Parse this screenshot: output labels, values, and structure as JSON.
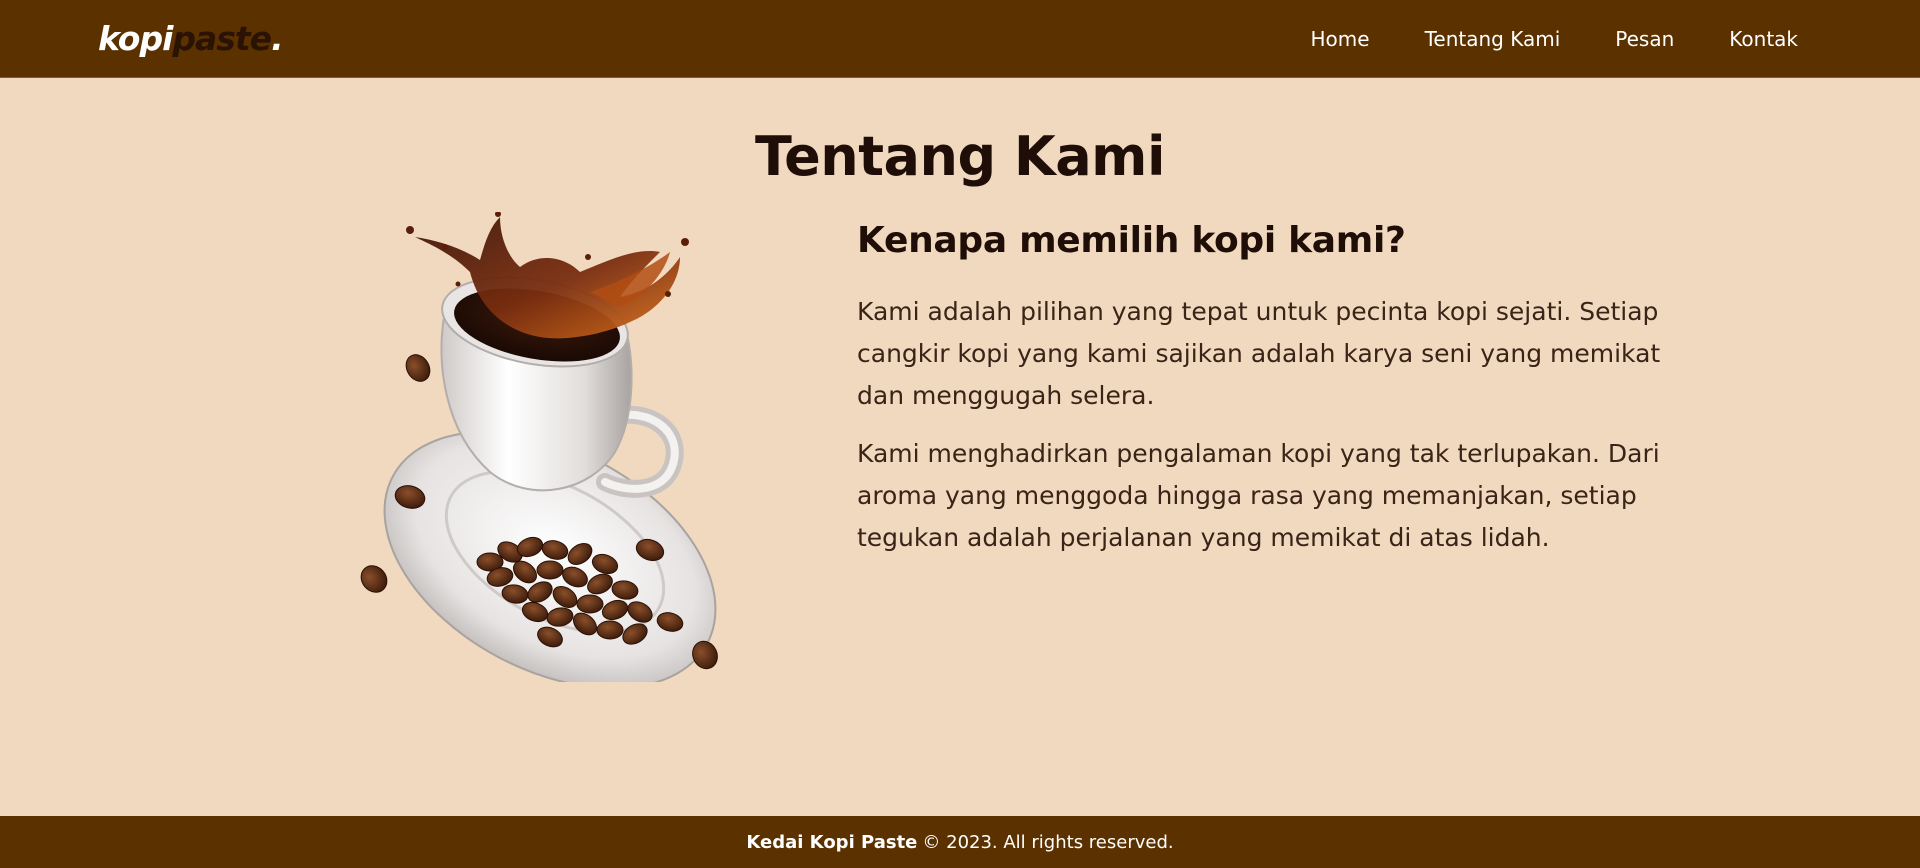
{
  "nav": {
    "logo_part1": "kopi",
    "logo_part2": "paste",
    "logo_part3": ".",
    "links": [
      "Home",
      "Tentang Kami",
      "Pesan",
      "Kontak"
    ]
  },
  "about": {
    "title": "Tentang Kami",
    "subtitle": "Kenapa memilih kopi kami?",
    "paragraph1": "Kami adalah pilihan yang tepat untuk pecinta kopi sejati. Setiap cangkir kopi yang kami sajikan adalah karya seni yang memikat dan menggugah selera.",
    "paragraph2": "Kami menghadirkan pengalaman kopi yang tak terlupakan. Dari aroma yang menggoda hingga rasa yang memanjakan, setiap tegukan adalah perjalanan yang memikat di atas lidah."
  },
  "footer": {
    "brand": "Kedai Kopi Paste",
    "copyright": "© 2023. All rights reserved."
  },
  "colors": {
    "navbar": "#5b3100",
    "page_bg": "#f0d9bf",
    "text_dark": "#1f0d07"
  }
}
